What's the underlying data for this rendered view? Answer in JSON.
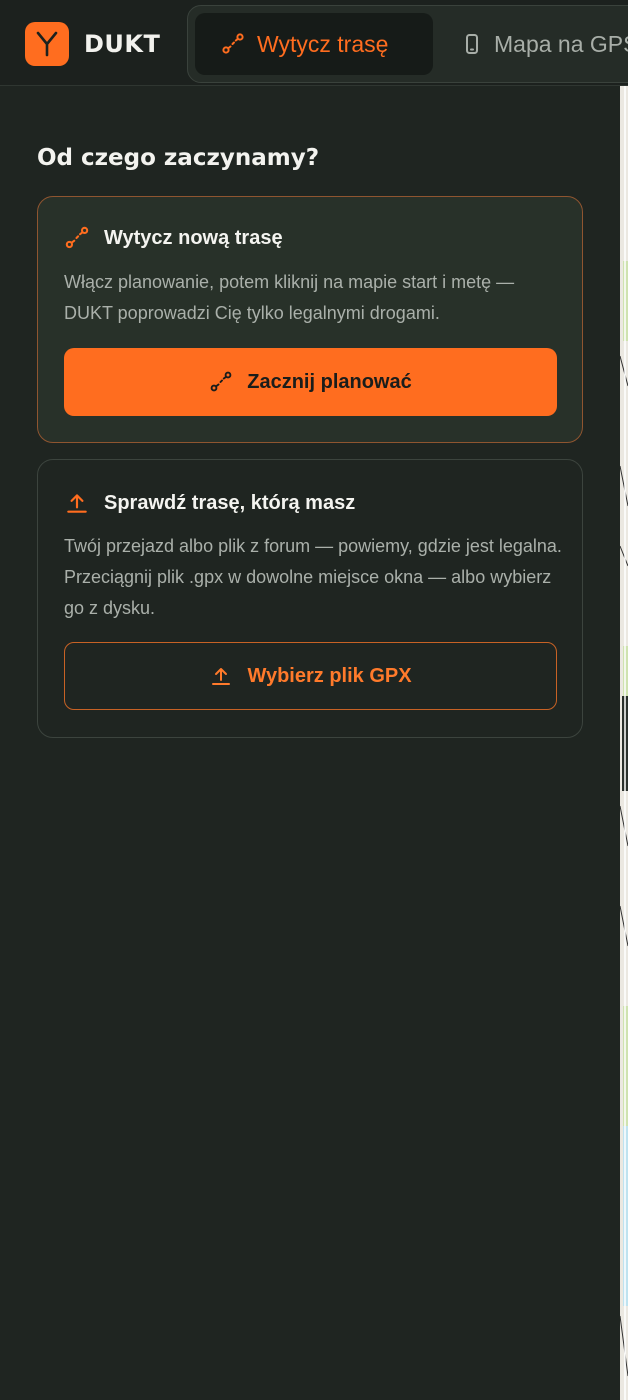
{
  "app": {
    "name": "DUKT",
    "logo_letter": "Y",
    "brand_color": "#ff6d1f"
  },
  "tabs": [
    {
      "label": "Wytycz trasę",
      "icon": "route-icon",
      "active": true
    },
    {
      "label": "Mapa na GPS",
      "icon": "phone-icon",
      "active": false
    }
  ],
  "main": {
    "heading": "Od czego zaczynamy?",
    "cards": [
      {
        "title": "Wytycz nową trasę",
        "icon": "route-icon",
        "description": "Włącz planowanie, potem kliknij na mapie start i metę — DUKT poprowadzi Cię tylko legalnymi drogami.",
        "button_label": "Zacznij planować",
        "button_icon": "route-icon"
      },
      {
        "title": "Sprawdź trasę, którą masz",
        "icon": "upload-icon",
        "description": "Twój przejazd albo plik z forum — powiemy, gdzie jest legalna. Przeciągnij plik .gpx w dowolne miejsce okna — albo wybierz go z dysku.",
        "button_label": "Wybierz plik GPX",
        "button_icon": "upload-icon"
      }
    ]
  }
}
